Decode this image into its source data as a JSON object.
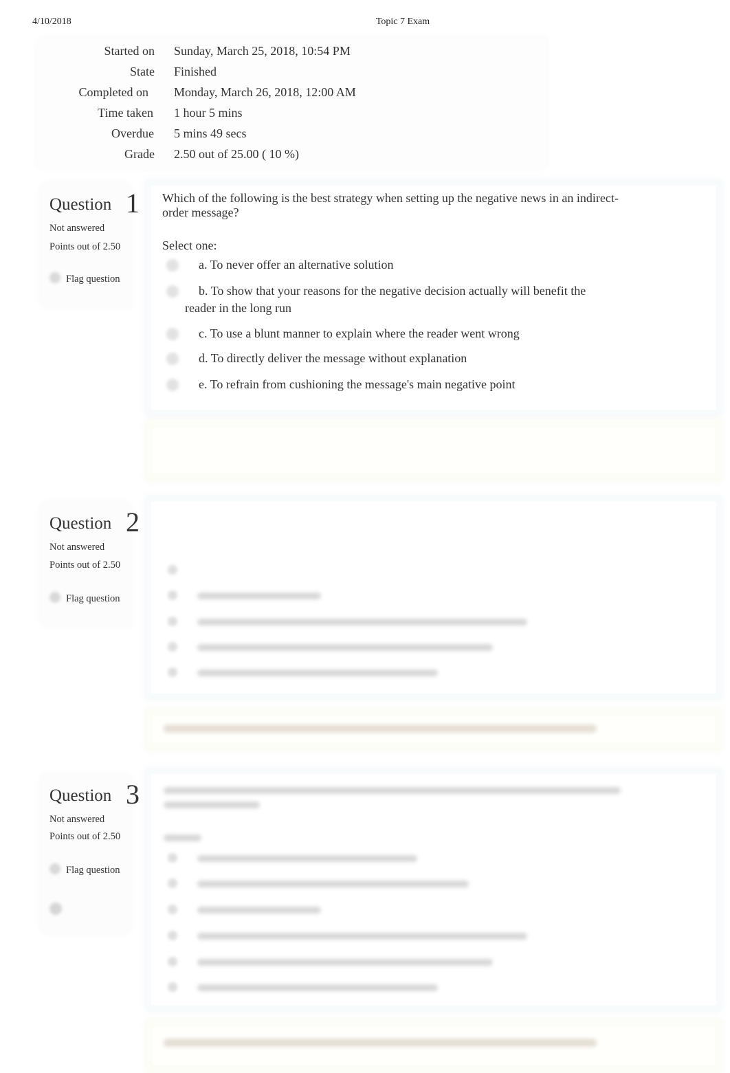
{
  "print_header": {
    "date": "4/10/2018",
    "title": "Topic 7 Exam"
  },
  "summary": {
    "rows": [
      {
        "label": "Started on",
        "value": "Sunday, March 25, 2018, 10:54 PM"
      },
      {
        "label": "State",
        "value": "Finished"
      },
      {
        "label": "Completed on",
        "value": "Monday, March 26, 2018, 12:00 AM"
      },
      {
        "label": "Time taken",
        "value": "1 hour 5 mins"
      },
      {
        "label": "Overdue",
        "value": "5 mins 49 secs"
      },
      {
        "label": "Grade",
        "value": "2.50  out of 25.00 ( 10 %)"
      }
    ]
  },
  "questions": [
    {
      "label": "Question",
      "number": "1",
      "state": "Not answered",
      "points": "Points out of 2.50",
      "flag_label": "Flag question",
      "text": "Which of the following is the best strategy when setting up the negative news in an indirect-order message?",
      "prompt": "Select one:",
      "options": [
        "a. To never offer an alternative solution",
        "b. To show that your reasons for the negative decision actually will benefit the reader in the long run",
        "c. To use a blunt manner to explain where the reader went wrong",
        "d. To directly deliver the message without explanation",
        "e. To refrain from cushioning the message's main negative point"
      ],
      "feedback_visible": false
    },
    {
      "label": "Question",
      "number": "2",
      "state": "Not answered",
      "points": "Points out of 2.50",
      "flag_label": "Flag question",
      "content_obscured": true,
      "obscured_option_count": 5,
      "feedback_obscured": true
    },
    {
      "label": "Question",
      "number": "3",
      "state": "Not answered",
      "points": "Points out of 2.50",
      "flag_label": "Flag question",
      "content_obscured": true,
      "obscured_option_count": 6,
      "feedback_obscured": true
    }
  ]
}
